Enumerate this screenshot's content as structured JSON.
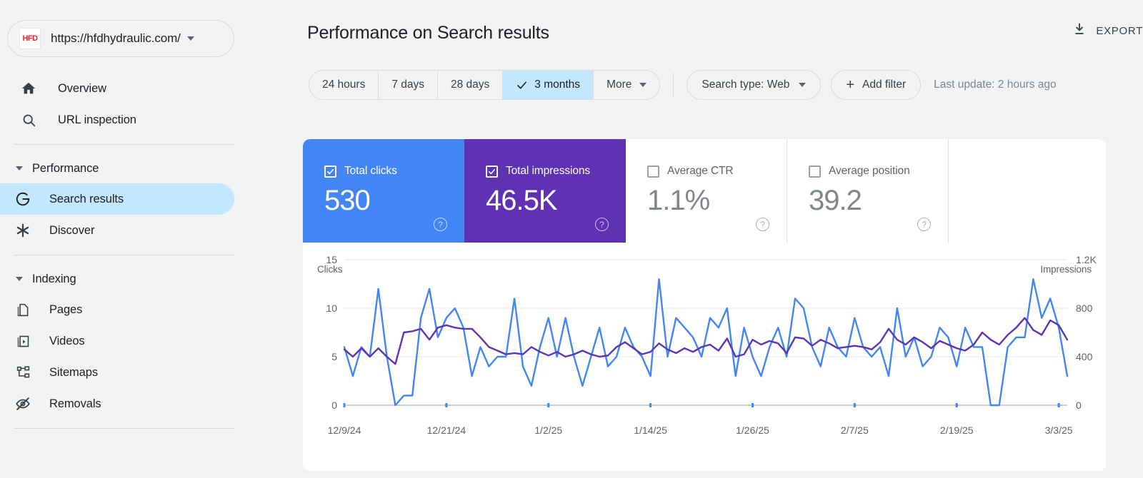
{
  "sidebar": {
    "property": {
      "logo_text": "HFD",
      "logo_icon": "site-logo",
      "url": "https://hfdhydraulic.com/"
    },
    "top_items": [
      {
        "label": "Overview",
        "icon": "home-icon",
        "active": false
      },
      {
        "label": "URL inspection",
        "icon": "search-icon",
        "active": false
      }
    ],
    "groups": [
      {
        "label": "Performance",
        "items": [
          {
            "label": "Search results",
            "icon": "google-g-icon",
            "active": true
          },
          {
            "label": "Discover",
            "icon": "asterisk-icon",
            "active": false
          }
        ]
      },
      {
        "label": "Indexing",
        "items": [
          {
            "label": "Pages",
            "icon": "pages-icon",
            "active": false
          },
          {
            "label": "Videos",
            "icon": "video-icon",
            "active": false
          },
          {
            "label": "Sitemaps",
            "icon": "sitemap-icon",
            "active": false
          },
          {
            "label": "Removals",
            "icon": "eye-off-icon",
            "active": false
          }
        ]
      }
    ]
  },
  "header": {
    "title": "Performance on Search results",
    "export_label": "EXPORT",
    "export_icon": "download-icon"
  },
  "toolbar": {
    "date_chips": [
      {
        "label": "24 hours",
        "selected": false
      },
      {
        "label": "7 days",
        "selected": false
      },
      {
        "label": "28 days",
        "selected": false
      },
      {
        "label": "3 months",
        "selected": true
      },
      {
        "label": "More",
        "selected": false,
        "has_dropdown": true
      }
    ],
    "search_type": "Search type: Web",
    "add_filter": "Add filter",
    "last_update": "Last update: 2 hours ago"
  },
  "metric_cards": [
    {
      "label": "Total clicks",
      "value": "530",
      "checked": true,
      "color": "#4285F4"
    },
    {
      "label": "Total impressions",
      "value": "46.5K",
      "checked": true,
      "color": "#5F32B4"
    },
    {
      "label": "Average CTR",
      "value": "1.1%",
      "checked": false,
      "color": "#FFFFFF"
    },
    {
      "label": "Average position",
      "value": "39.2",
      "checked": false,
      "color": "#FFFFFF"
    }
  ],
  "chart_data": {
    "type": "line",
    "title": "",
    "ylabel_left": "Clicks",
    "ylabel_right": "Impressions",
    "yticks_left": [
      "0",
      "5",
      "10",
      "15"
    ],
    "yticks_left_values": [
      0,
      5,
      10,
      15
    ],
    "yticks_right": [
      "0",
      "400",
      "800",
      "1.2K"
    ],
    "yticks_right_values": [
      0,
      400,
      800,
      1200
    ],
    "ylim_left": [
      0,
      15
    ],
    "ylim_right": [
      0,
      1200
    ],
    "grid": true,
    "legend_position": "none",
    "xlabels": [
      "12/9/24",
      "12/21/24",
      "1/2/25",
      "1/14/25",
      "1/26/25",
      "2/7/25",
      "2/19/25",
      "3/3/25"
    ],
    "xlabel_indices": [
      0,
      12,
      24,
      36,
      48,
      60,
      72,
      84
    ],
    "series": [
      {
        "name": "Clicks",
        "color": "#4285F4",
        "axis": "left",
        "values": [
          6,
          3,
          6,
          5,
          12,
          5,
          0,
          1,
          1,
          9,
          12,
          7,
          9,
          10,
          8,
          3,
          6,
          4,
          5,
          5,
          11,
          4,
          2,
          6,
          9,
          5,
          9,
          5,
          2,
          5,
          8,
          4,
          5,
          8,
          6,
          5,
          3,
          13,
          5,
          9,
          8,
          7,
          5,
          9,
          8,
          10,
          3,
          8,
          5,
          3,
          6,
          8,
          5,
          11,
          10,
          6,
          4,
          8,
          6,
          5,
          9,
          6,
          5,
          6,
          3,
          10,
          5,
          7,
          4,
          5,
          8,
          7,
          4,
          8,
          6,
          6,
          0,
          0,
          6,
          7,
          7,
          13,
          9,
          11,
          8,
          3
        ]
      },
      {
        "name": "Impressions",
        "color": "#5E35B1",
        "axis": "right",
        "values": [
          460,
          400,
          470,
          400,
          470,
          400,
          340,
          600,
          610,
          630,
          540,
          640,
          660,
          640,
          630,
          630,
          560,
          480,
          450,
          420,
          430,
          420,
          480,
          440,
          410,
          440,
          400,
          420,
          450,
          420,
          400,
          410,
          480,
          520,
          470,
          420,
          440,
          510,
          460,
          430,
          470,
          440,
          480,
          500,
          450,
          550,
          400,
          420,
          540,
          500,
          530,
          510,
          430,
          560,
          550,
          490,
          540,
          510,
          470,
          480,
          490,
          480,
          460,
          520,
          630,
          540,
          500,
          560,
          520,
          470,
          530,
          500,
          470,
          450,
          500,
          600,
          540,
          500,
          580,
          640,
          720,
          620,
          580,
          700,
          660,
          540
        ]
      }
    ]
  }
}
